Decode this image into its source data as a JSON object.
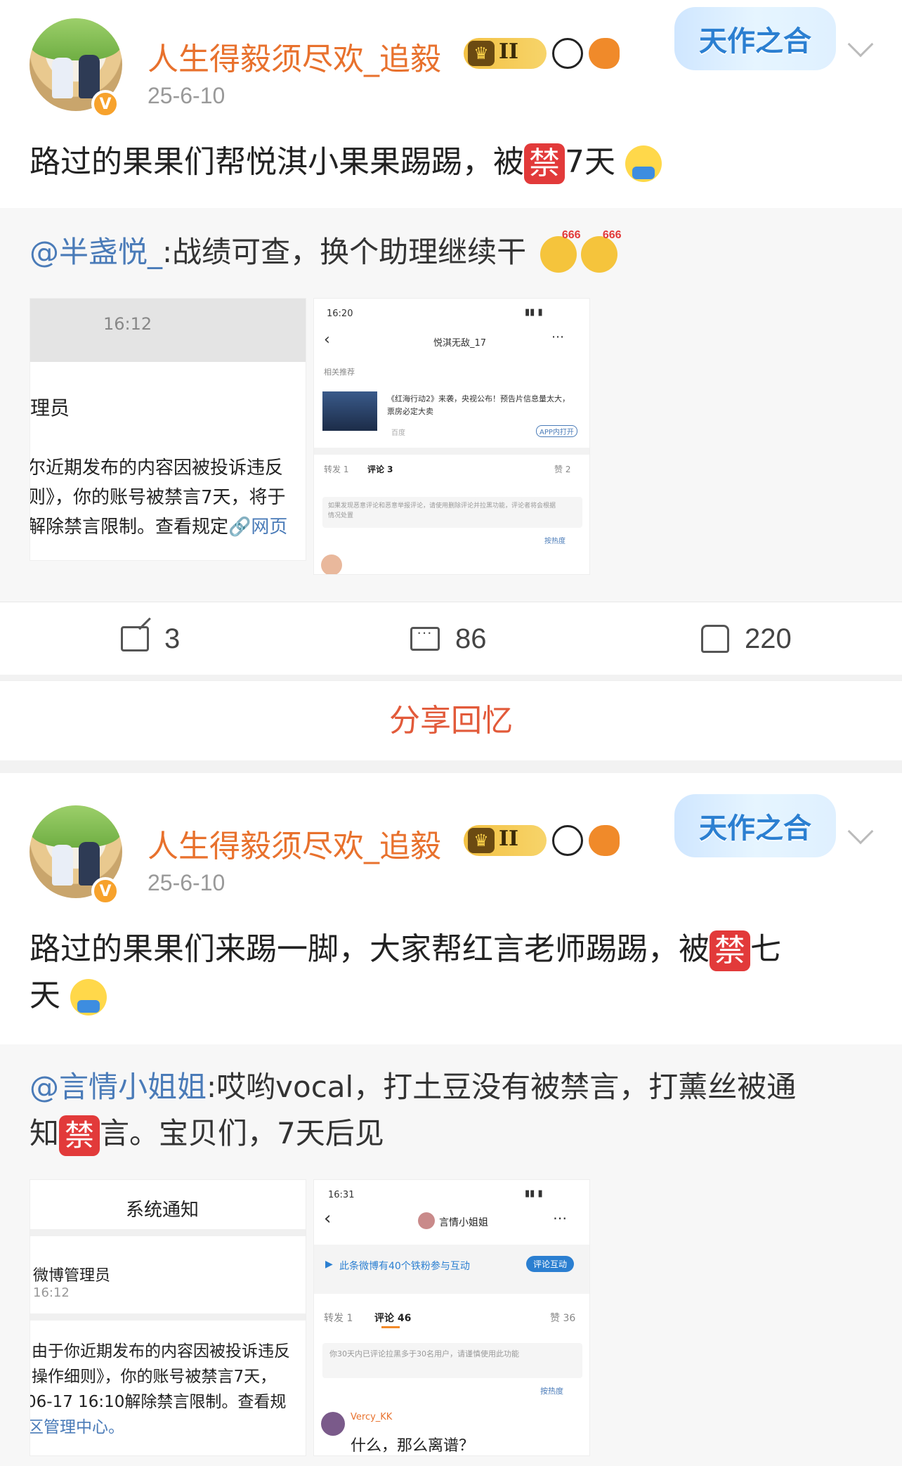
{
  "posts": [
    {
      "username": "人生得毅须尽欢_追毅",
      "date": "25-6-10",
      "level_badge": "II",
      "topic_badge": "天作之合",
      "text_before_ban": "路过的果果们帮悦淇小果果踢踢，被",
      "ban_glyph": "禁",
      "text_after_ban": "7天",
      "retweet": {
        "mention": "@半盏悦_",
        "text": ":战绩可查，换个助理继续干",
        "shot_left": {
          "time": "16:12",
          "role": "理员",
          "lines": [
            "尔近期发布的内容因被投诉违反",
            "则》，你的账号被禁言7天，将于",
            "解除禁言限制。查看规定"
          ],
          "link": "网页"
        },
        "shot_right": {
          "status": "16:20",
          "title": "悦淇无敌_17",
          "related": "相关推荐",
          "news": "《红海行动2》来袭，央视公布！预告片信息量太大，票房必定大卖",
          "source": "百度",
          "app_btn": "APP内打开",
          "tabs": [
            "转发 1",
            "评论 3",
            "赞 2"
          ],
          "notice": "如果发现恶意评论和恶意举报评论，请使用删除评论并拉黑功能，评论者将会根据情况处置",
          "sort": "按热度"
        }
      },
      "actions": {
        "repost": "3",
        "comment": "86",
        "like": "220"
      },
      "share_memory": "分享回忆"
    },
    {
      "username": "人生得毅须尽欢_追毅",
      "date": "25-6-10",
      "level_badge": "II",
      "topic_badge": "天作之合",
      "text_line1_before": "路过的果果们来踢一脚，大家帮红言老师踢踢，被",
      "ban_glyph": "禁",
      "text_line1_after": "七",
      "text_line2": "天",
      "retweet": {
        "mention": "@言情小姐姐",
        "text_line1": ":哎哟vocal，打土豆没有被禁言，打薰丝被通",
        "text_line2_before": "知",
        "text_line2_after": "言。宝贝们，7天后见",
        "shot_left": {
          "header": "系统通知",
          "sender": "微博管理员",
          "time": "16:12",
          "lines": [
            "由于你近期发布的内容因被投诉违反",
            "操作细则》，你的账号被禁言7天，",
            "06-17 16:10解除禁言限制。查看规",
            "区管理中心。"
          ]
        },
        "shot_right": {
          "status": "16:31",
          "title": "言情小姐姐",
          "fans_notice": "此条微博有40个铁粉参与互动",
          "fans_btn": "评论互动",
          "tabs": [
            "转发 1",
            "评论 46",
            "赞 36"
          ],
          "notice": "你30天内已评论拉黑多于30名用户，请谨慎使用此功能",
          "sort": "按热度",
          "commenter": "Vercy_KK",
          "comment": "什么，那么离谱？"
        }
      }
    }
  ]
}
